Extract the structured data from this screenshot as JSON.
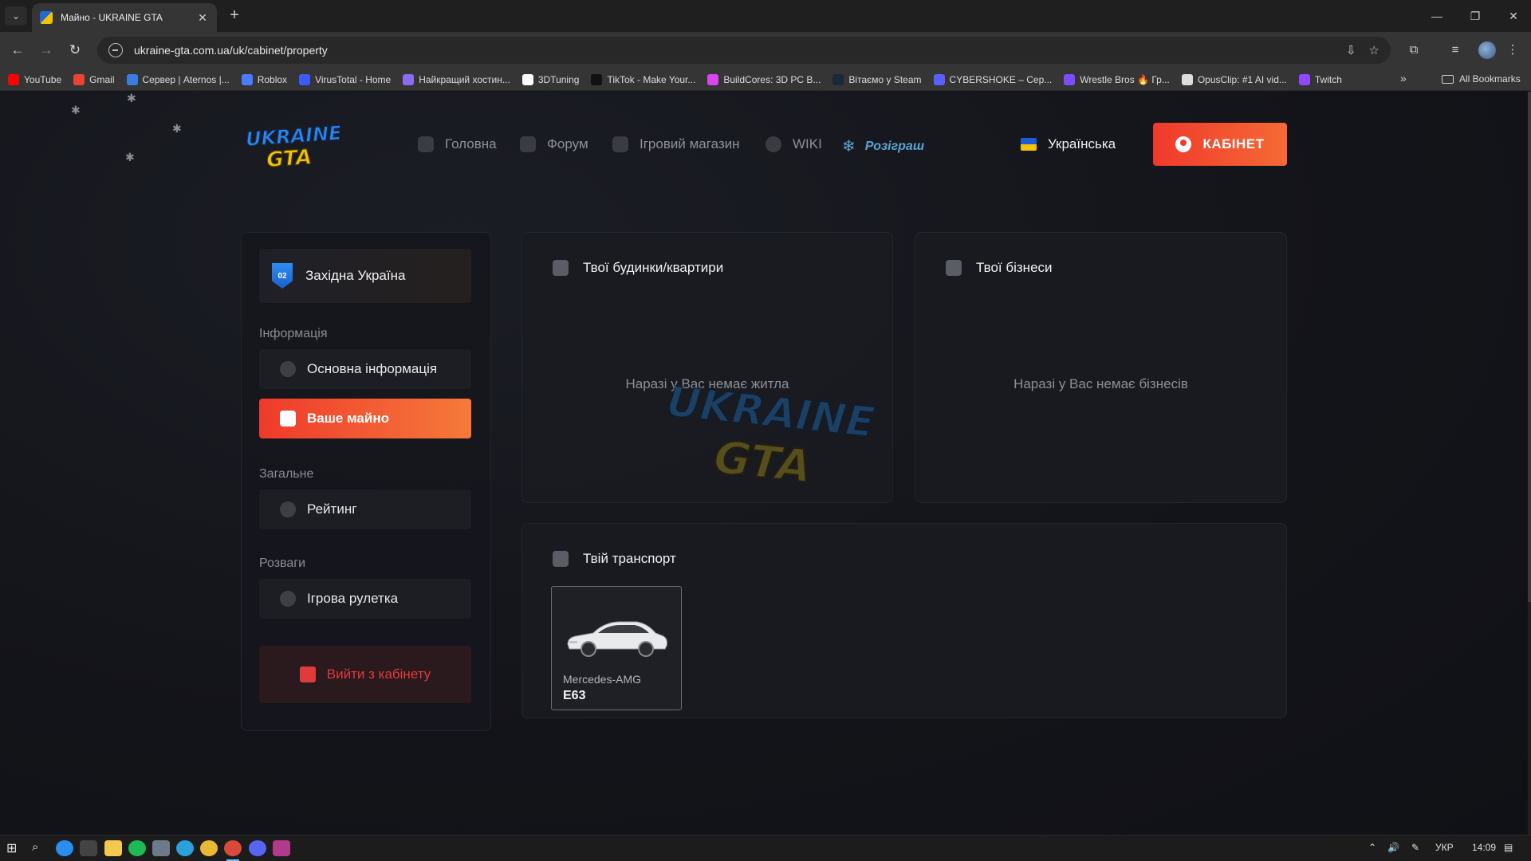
{
  "browser": {
    "tab_title": "Майно - UKRAINE GTA",
    "tab_close": "✕",
    "new_tab": "+",
    "url": "ukraine-gta.com.ua/uk/cabinet/property",
    "window_buttons": {
      "minimize": "—",
      "restore": "❐",
      "close": "✕"
    },
    "bookmarks": [
      {
        "label": "YouTube",
        "color": "#ff0000"
      },
      {
        "label": "Gmail",
        "color": "#ea4335"
      },
      {
        "label": "Сервер | Aternos |...",
        "color": "#3a7be0"
      },
      {
        "label": "Roblox",
        "color": "#4a7cff"
      },
      {
        "label": "VirusTotal - Home",
        "color": "#3d5afe"
      },
      {
        "label": "Найкращий хостин...",
        "color": "#8a6cf0"
      },
      {
        "label": "3DTuning",
        "color": "#ffffff"
      },
      {
        "label": "TikTok - Make Your...",
        "color": "#111111"
      },
      {
        "label": "BuildCores: 3D PC B...",
        "color": "#d946ef"
      },
      {
        "label": "Вітаємо у Steam",
        "color": "#1b2838"
      },
      {
        "label": "CYBERSHOKE – Сер...",
        "color": "#5a5fff"
      },
      {
        "label": "Wrestle Bros 🔥 Гр...",
        "color": "#7c4dff"
      },
      {
        "label": "OpusClip: #1 AI vid...",
        "color": "#dddddd"
      },
      {
        "label": "Twitch",
        "color": "#9146ff"
      }
    ],
    "bookmarks_more": "»",
    "all_bookmarks": "All Bookmarks"
  },
  "site": {
    "nav": [
      {
        "label": "Головна",
        "icon": "home-icon"
      },
      {
        "label": "Форум",
        "icon": "hash-icon"
      },
      {
        "label": "Ігровий магазин",
        "icon": "bag-icon"
      },
      {
        "label": "WIKI",
        "icon": "globe-icon"
      }
    ],
    "raffle_label": "Розіграш",
    "language": "Українська",
    "cabinet_button": "КАБІНЕТ"
  },
  "sidebar": {
    "server_name": "Західна Україна",
    "server_badge": "02",
    "sections": {
      "info": "Інформація",
      "general": "Загальне",
      "fun": "Розваги"
    },
    "items": {
      "main_info": "Основна інформація",
      "property": "Ваше майно",
      "rating": "Рейтинг",
      "roulette": "Ігрова рулетка"
    },
    "logout": "Вийти з кабінету"
  },
  "property": {
    "houses_title": "Твої будинки/квартири",
    "houses_empty": "Наразі у Вас немає житла",
    "business_title": "Твої бізнеси",
    "business_empty": "Наразі у Вас немає бізнесів",
    "transport_title": "Твій транспорт",
    "vehicles": [
      {
        "brand": "Mercedes-AMG",
        "model": "E63"
      }
    ]
  },
  "taskbar": {
    "lang": "УКР",
    "time": "14:09"
  },
  "colors": {
    "accent": "#ef3a2b",
    "accent_end": "#f57a3a",
    "logout_text": "#e03b3b"
  }
}
